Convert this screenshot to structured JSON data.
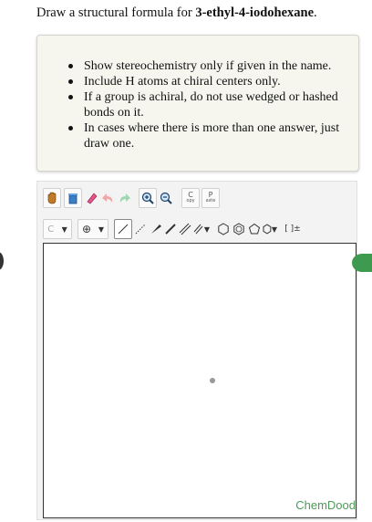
{
  "question": {
    "prefix": "Draw a structural formula for ",
    "compound": "3-ethyl-4-iodohexane",
    "suffix": "."
  },
  "instructions": [
    "Show stereochemistry only if given in the name.",
    "Include H atoms at chiral centers only.",
    "If a group is achiral, do not use wedged or hashed bonds on it.",
    "In cases where there is more than one answer, just draw one."
  ],
  "toolbar": {
    "copy_label_top": "C",
    "copy_label_bottom": "opy",
    "paste_label_top": "P",
    "paste_label_bottom": "aste",
    "atom_label": "C",
    "charge_label": "⊕",
    "bracket_label": "[ ]±"
  },
  "canvas": {
    "brand": "ChemDood"
  }
}
